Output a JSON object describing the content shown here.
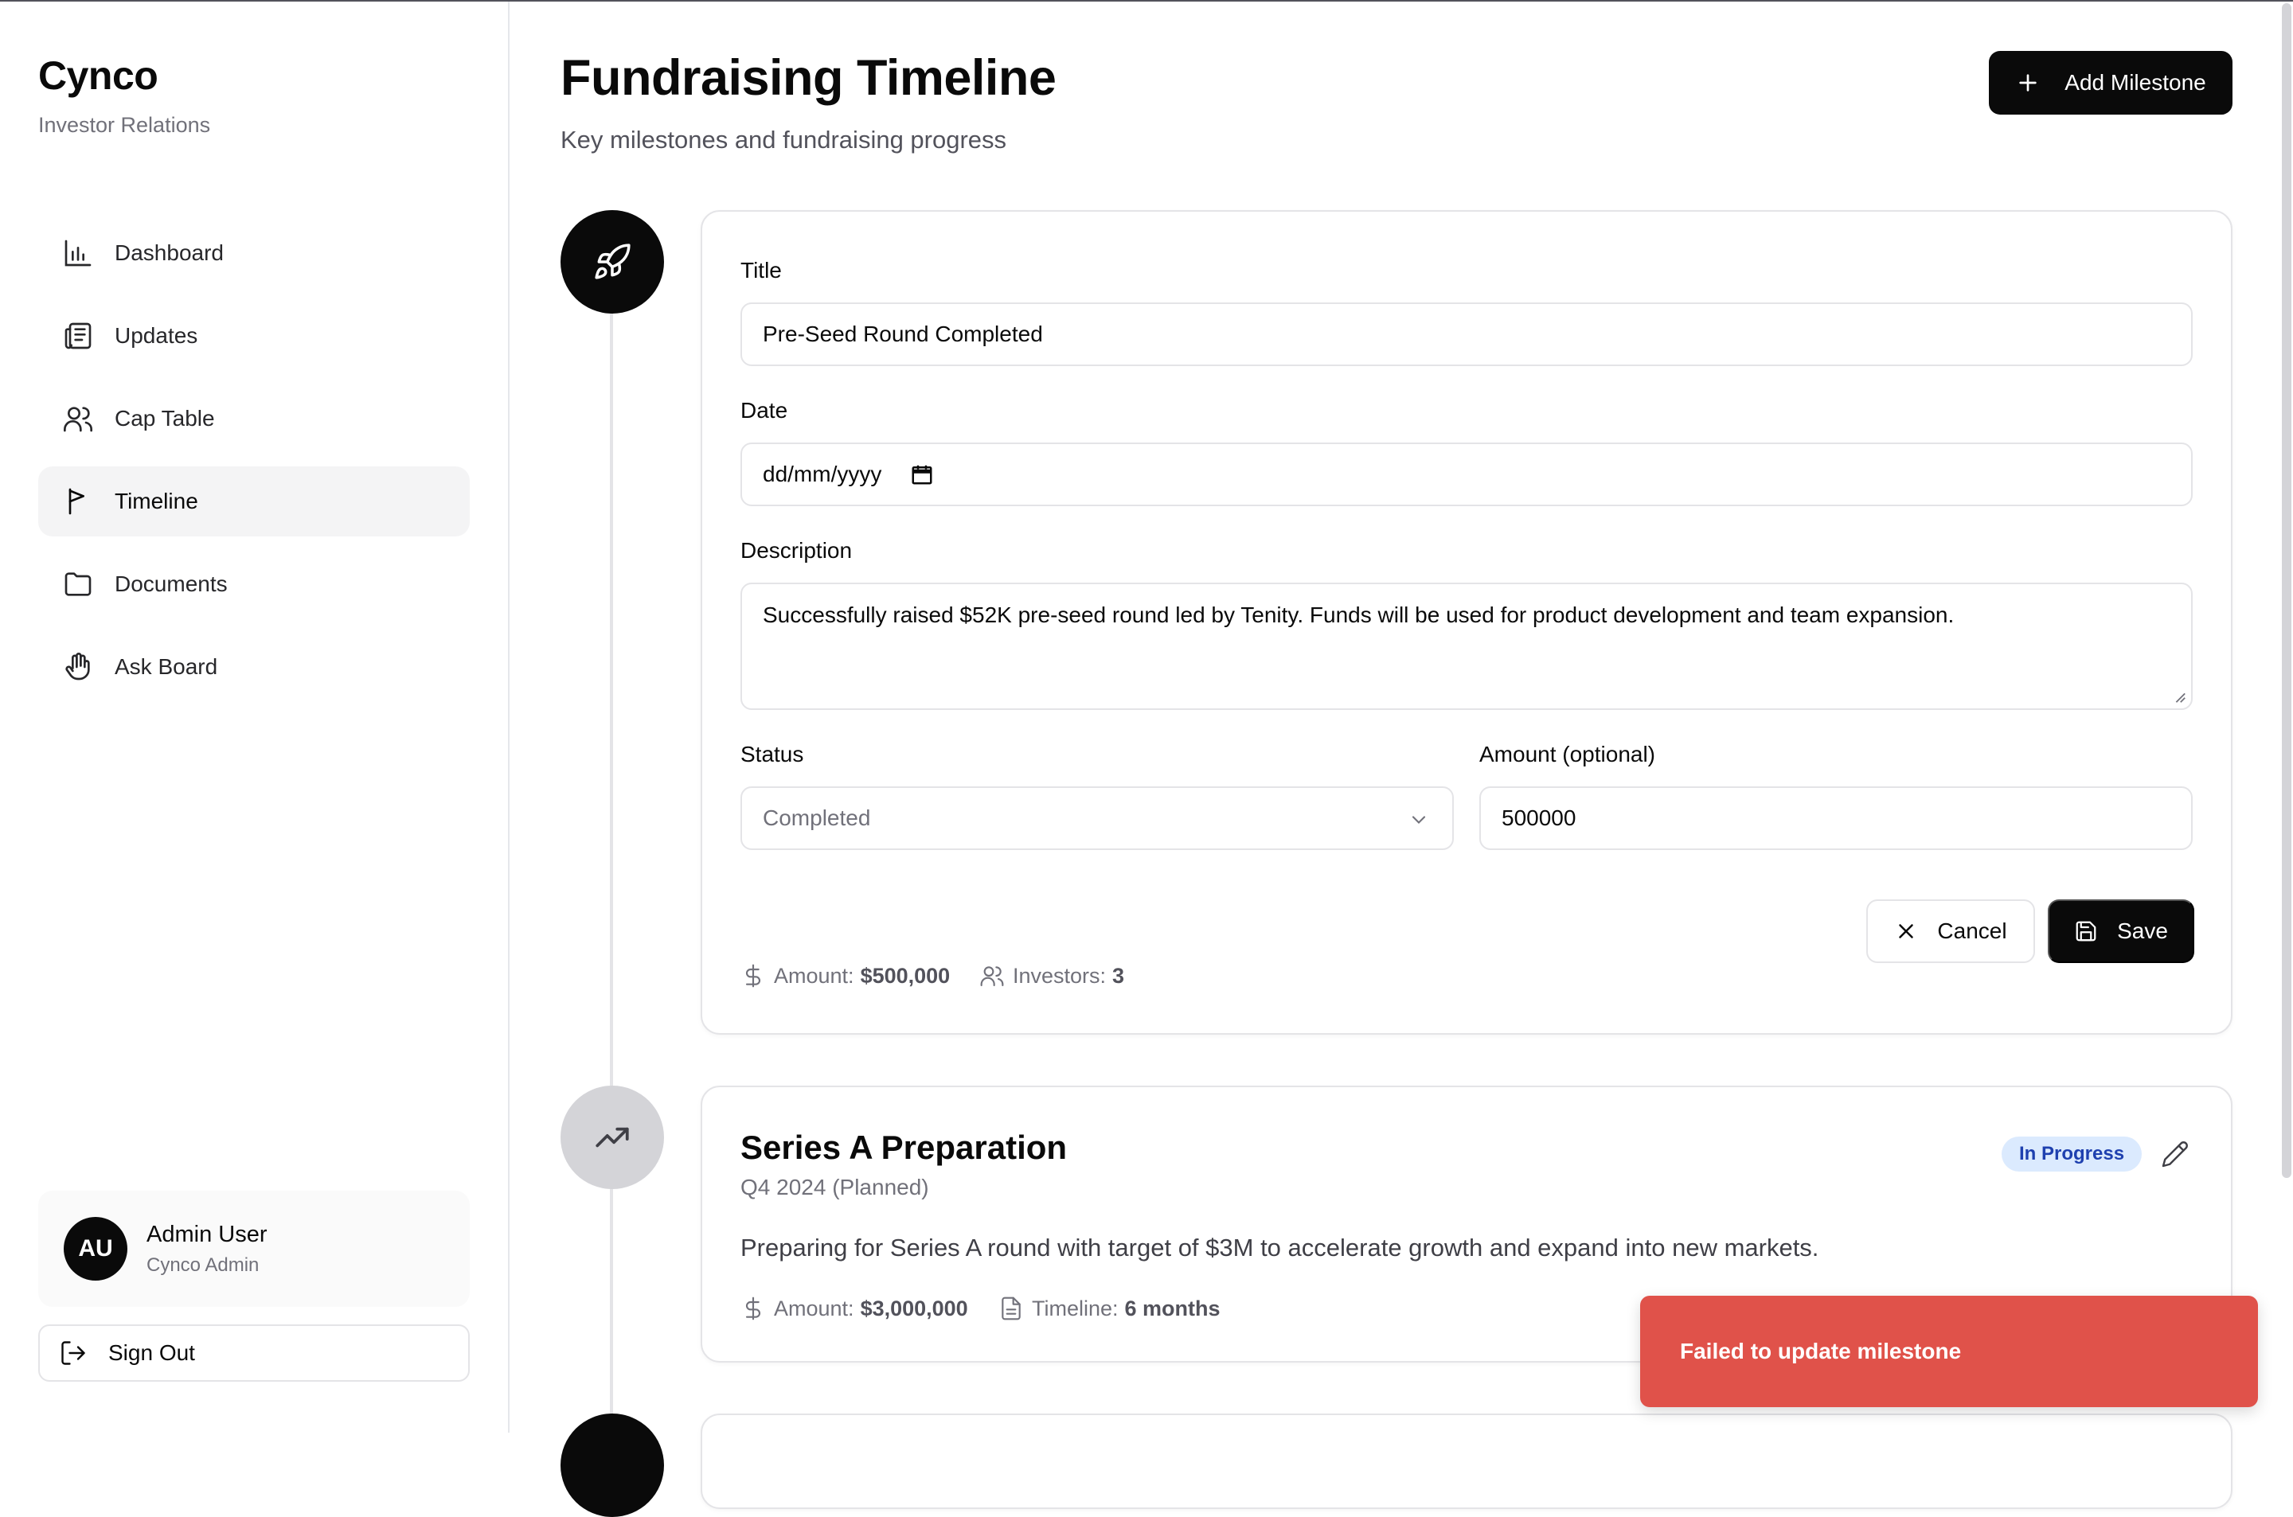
{
  "sidebar": {
    "brand": "Cynco",
    "subtitle": "Investor Relations",
    "items": [
      {
        "label": "Dashboard",
        "icon": "bar-chart-icon"
      },
      {
        "label": "Updates",
        "icon": "newspaper-icon"
      },
      {
        "label": "Cap Table",
        "icon": "users-icon"
      },
      {
        "label": "Timeline",
        "icon": "flag-icon",
        "active": true
      },
      {
        "label": "Documents",
        "icon": "folder-icon"
      },
      {
        "label": "Ask Board",
        "icon": "hand-icon"
      }
    ],
    "user": {
      "initials": "AU",
      "name": "Admin User",
      "role": "Cynco Admin"
    },
    "sign_out": "Sign Out"
  },
  "header": {
    "title": "Fundraising Timeline",
    "subtitle": "Key milestones and fundraising progress",
    "add_button": "Add Milestone"
  },
  "edit_form": {
    "title_label": "Title",
    "title_value": "Pre-Seed Round Completed",
    "date_label": "Date",
    "date_placeholder": "dd/mm/yyyy",
    "description_label": "Description",
    "description_value": "Successfully raised $52K pre-seed round led by Tenity. Funds will be used for product development and team expansion.",
    "status_label": "Status",
    "status_value": "Completed",
    "amount_label": "Amount (optional)",
    "amount_value": "500000",
    "cancel": "Cancel",
    "save": "Save",
    "meta_amount_label": "Amount:",
    "meta_amount_value": "$500,000",
    "meta_investors_label": "Investors:",
    "meta_investors_value": "3"
  },
  "milestone2": {
    "title": "Series A Preparation",
    "date": "Q4 2024 (Planned)",
    "badge": "In Progress",
    "description": "Preparing for Series A round with target of $3M to accelerate growth and expand into new markets.",
    "meta_amount_label": "Amount:",
    "meta_amount_value": "$3,000,000",
    "meta_timeline_label": "Timeline:",
    "meta_timeline_value": "6 months"
  },
  "toast": {
    "message": "Failed to update milestone"
  },
  "colors": {
    "accent": "#0a0a0a",
    "toast": "#e0524a",
    "badge_bg": "#dbeafe",
    "badge_text": "#1e40af"
  }
}
